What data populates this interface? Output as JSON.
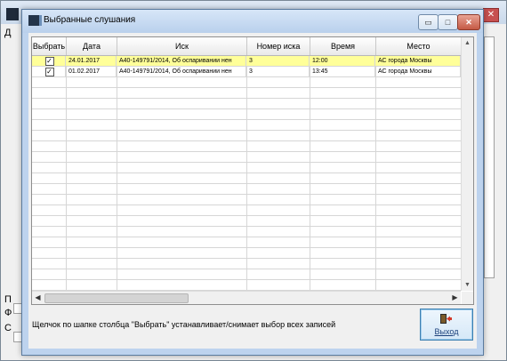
{
  "background_window": {
    "side_chars": [
      "Д",
      "П",
      "Ф",
      "С"
    ],
    "close_label": "✕"
  },
  "dialog": {
    "title": "Выбранные слушания",
    "window_buttons": {
      "minimize": "▭",
      "maximize": "□",
      "close": "✕"
    }
  },
  "grid": {
    "columns": [
      "Выбрать",
      "Дата",
      "Иск",
      "Номер иска",
      "Время",
      "Место"
    ],
    "rows": [
      {
        "checked": true,
        "date": "24.01.2017",
        "claim": "А40-149791/2014, Об оспаривании нен",
        "claim_no": "3",
        "time": "12:00",
        "place": "АС города Москвы",
        "selected": true
      },
      {
        "checked": true,
        "date": "01.02.2017",
        "claim": "А40-149791/2014, Об оспаривании нен",
        "claim_no": "3",
        "time": "13:45",
        "place": "АС города Москвы",
        "selected": false
      }
    ],
    "scroll_glyphs": {
      "up": "▲",
      "down": "▼",
      "left": "◀",
      "right": "▶"
    }
  },
  "hint": "Щелчок по шапке столбца \"Выбрать\" устанавливает/снимает выбор всех записей",
  "exit_button": {
    "label": "Выход",
    "icon": "exit-door-icon"
  }
}
